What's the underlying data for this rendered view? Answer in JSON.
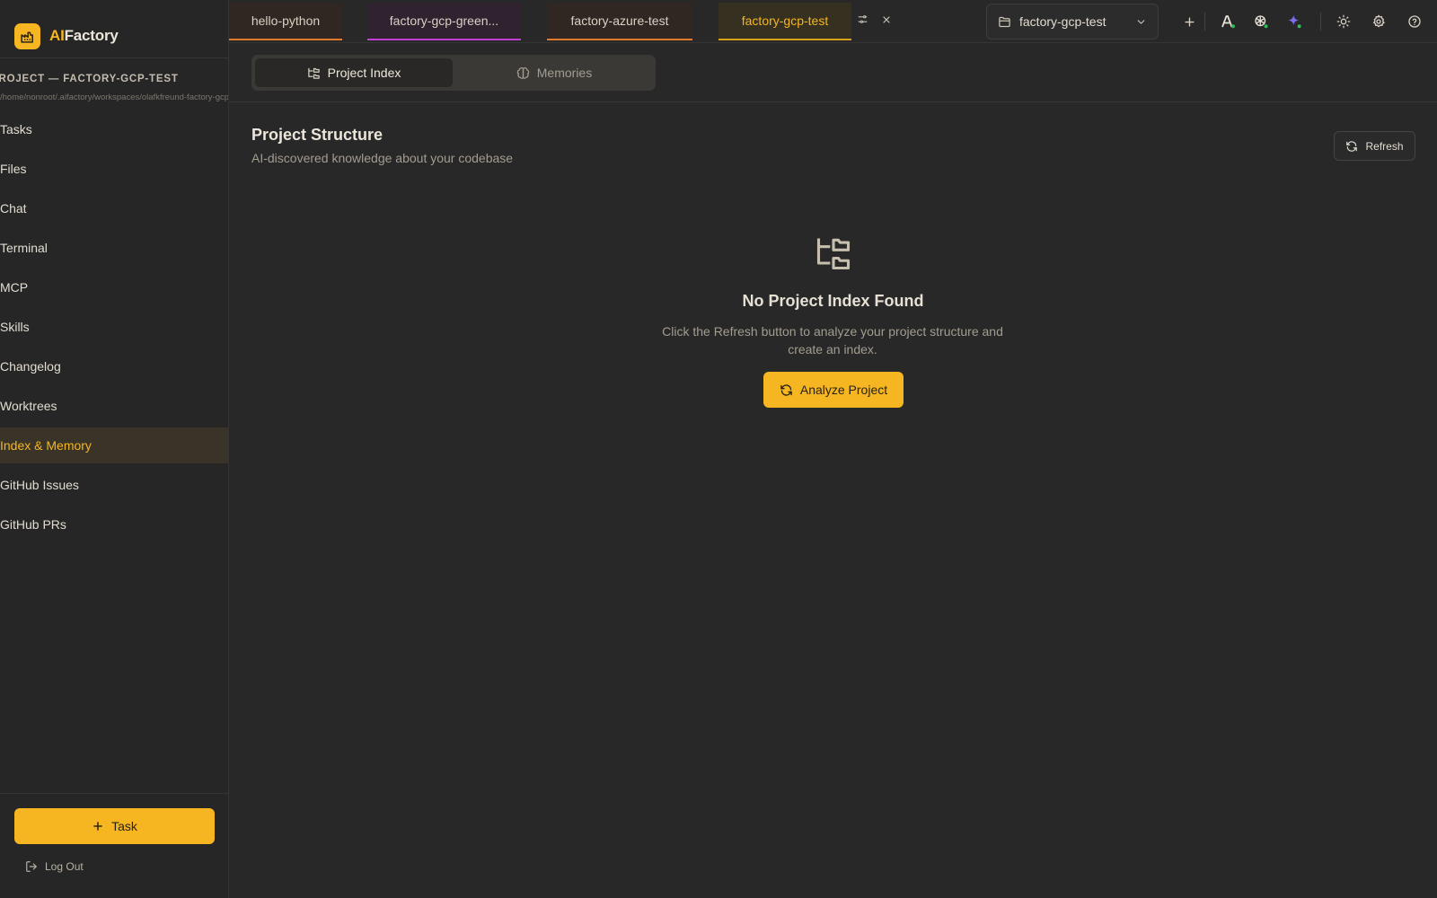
{
  "brand": {
    "prefix": "AI",
    "suffix": "Factory"
  },
  "sidebar": {
    "project_heading": "PROJECT — FACTORY-GCP-TEST",
    "project_path": "/home/nonroot/.aifactory/workspaces/olafkfreund-factory-gcp-test",
    "items": [
      {
        "label": "Tasks"
      },
      {
        "label": "Files"
      },
      {
        "label": "Chat"
      },
      {
        "label": "Terminal"
      },
      {
        "label": "MCP"
      },
      {
        "label": "Skills"
      },
      {
        "label": "Changelog"
      },
      {
        "label": "Worktrees"
      },
      {
        "label": "Index & Memory",
        "active": true
      },
      {
        "label": "GitHub Issues"
      },
      {
        "label": "GitHub PRs"
      }
    ],
    "task_button": "Task",
    "logout": "Log Out"
  },
  "tabs": [
    {
      "label": "hello-python",
      "accent": "#e07a2e"
    },
    {
      "label": "factory-gcp-green...",
      "accent": "#c13fd6"
    },
    {
      "label": "factory-azure-test",
      "accent": "#e07a2e"
    },
    {
      "label": "factory-gcp-test",
      "accent": "#d9a21a",
      "active": true
    }
  ],
  "project_select": {
    "value": "factory-gcp-test"
  },
  "subtabs": {
    "index": "Project Index",
    "memories": "Memories"
  },
  "main": {
    "title": "Project Structure",
    "subtitle": "AI-discovered knowledge about your codebase",
    "refresh": "Refresh",
    "empty_title": "No Project Index Found",
    "empty_desc": "Click the Refresh button to analyze your project structure and create an index.",
    "analyze": "Analyze Project"
  },
  "colors": {
    "accent": "#f5b622",
    "background": "#282828",
    "status_dot": "#2fbf5a"
  }
}
